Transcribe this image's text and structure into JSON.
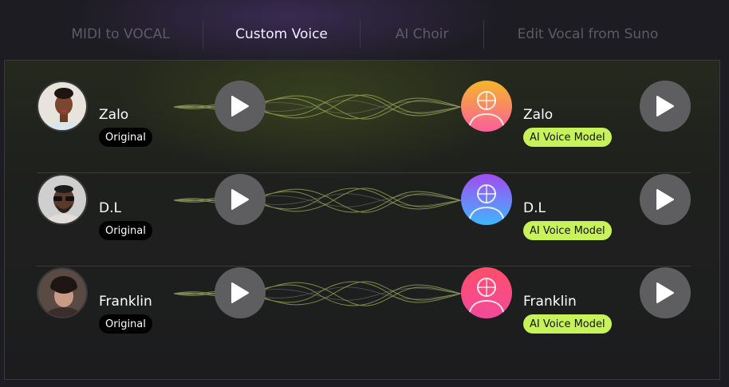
{
  "tabs": [
    {
      "label": "MIDI to VOCAL",
      "active": false
    },
    {
      "label": "Custom Voice",
      "active": true
    },
    {
      "label": "AI Choir",
      "active": false
    },
    {
      "label": "Edit Vocal from Suno",
      "active": false
    }
  ],
  "rows": [
    {
      "original": {
        "name": "Zalo",
        "badge": "Original",
        "avatar": "avatar-woman-photo"
      },
      "ai": {
        "name": "Zalo",
        "badge": "AI Voice Model",
        "icon": "ai-voice-icon",
        "colors": [
          "#f7b733",
          "#fc4a9a"
        ]
      }
    },
    {
      "original": {
        "name": "D.L",
        "badge": "Original",
        "avatar": "avatar-man-sunglasses-photo"
      },
      "ai": {
        "name": "D.L",
        "badge": "AI Voice Model",
        "icon": "ai-voice-icon",
        "colors": [
          "#a24bf0",
          "#3fb6ff"
        ]
      }
    },
    {
      "original": {
        "name": "Franklin",
        "badge": "Original",
        "avatar": "avatar-man-curly-photo"
      },
      "ai": {
        "name": "Franklin",
        "badge": "AI Voice Model",
        "icon": "ai-voice-icon",
        "colors": [
          "#ff4e6a",
          "#f24a9c"
        ]
      }
    }
  ],
  "colors": {
    "accent": "#c8f25a",
    "play_button": "#5e5e60",
    "wave": "#a9b85a"
  }
}
